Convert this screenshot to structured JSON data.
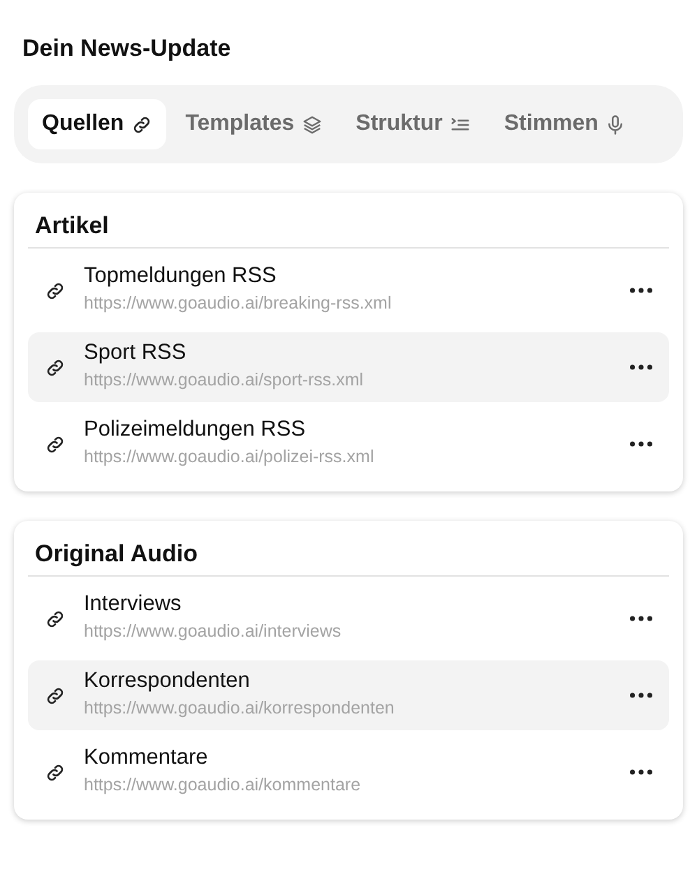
{
  "title": "Dein News-Update",
  "tabs": [
    {
      "label": "Quellen",
      "kind": "link",
      "selected": true
    },
    {
      "label": "Templates",
      "kind": "layers",
      "selected": false
    },
    {
      "label": "Struktur",
      "kind": "list",
      "selected": false
    },
    {
      "label": "Stimmen",
      "kind": "mic",
      "selected": false
    }
  ],
  "sections": [
    {
      "heading": "Artikel",
      "items": [
        {
          "name": "Topmeldungen RSS",
          "url": "https://www.goaudio.ai/breaking-rss.xml",
          "highlighted": false
        },
        {
          "name": "Sport RSS",
          "url": "https://www.goaudio.ai/sport-rss.xml",
          "highlighted": true
        },
        {
          "name": "Polizeimeldungen RSS",
          "url": "https://www.goaudio.ai/polizei-rss.xml",
          "highlighted": false
        }
      ]
    },
    {
      "heading": "Original Audio",
      "items": [
        {
          "name": "Interviews",
          "url": "https://www.goaudio.ai/interviews",
          "highlighted": false
        },
        {
          "name": "Korrespondenten",
          "url": "https://www.goaudio.ai/korrespondenten",
          "highlighted": true
        },
        {
          "name": "Kommentare",
          "url": "https://www.goaudio.ai/kommentare",
          "highlighted": false
        }
      ]
    }
  ]
}
